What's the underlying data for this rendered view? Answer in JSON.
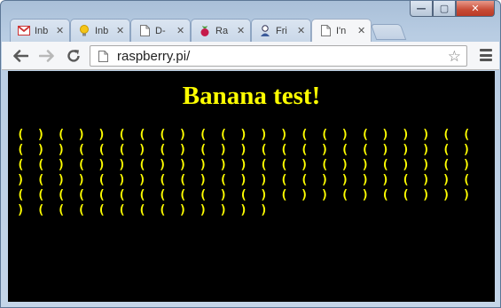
{
  "window": {
    "controls": {
      "minimize": "—",
      "maximize": "▢",
      "close": "✕"
    }
  },
  "tabs": [
    {
      "label": "Inb",
      "icon": "gmail-icon",
      "active": false
    },
    {
      "label": "Inb",
      "icon": "lightbulb-icon",
      "active": false
    },
    {
      "label": "D-",
      "icon": "document-icon",
      "active": false
    },
    {
      "label": "Ra",
      "icon": "raspberry-icon",
      "active": false
    },
    {
      "label": "Fri",
      "icon": "person-icon",
      "active": false
    },
    {
      "label": "I'n",
      "icon": "document-icon",
      "active": true
    }
  ],
  "toolbar": {
    "url": "raspberry.pi/"
  },
  "page": {
    "heading": "Banana test!",
    "parens_text": "( ) ( ) ) ( ( ( ) ( ( ) ) ) ( ( ) ( ) ) ) ( ( ( ) ) ( ( ( ) ( ) ( ) ) ( ( ( ) ( ( ) ) ) ( ) ( ( ) ( ) ) ( ) ) ) ) ) ( ( ) ( ) ) ( ) ) ( ) ) ( ) ) ( ) ) ( ( ) ( ) ) ( ( ) ) ) ) ( ) ) ( ( ( ( ( ( ( ( ( ( ( ) ( ) ( ) ) ( ) ( ( ) ) ) ) ( ( ( ( ( ( ( ) ) ) ) )"
  },
  "colors": {
    "page_background": "#000000",
    "text_yellow": "#ffff00"
  }
}
